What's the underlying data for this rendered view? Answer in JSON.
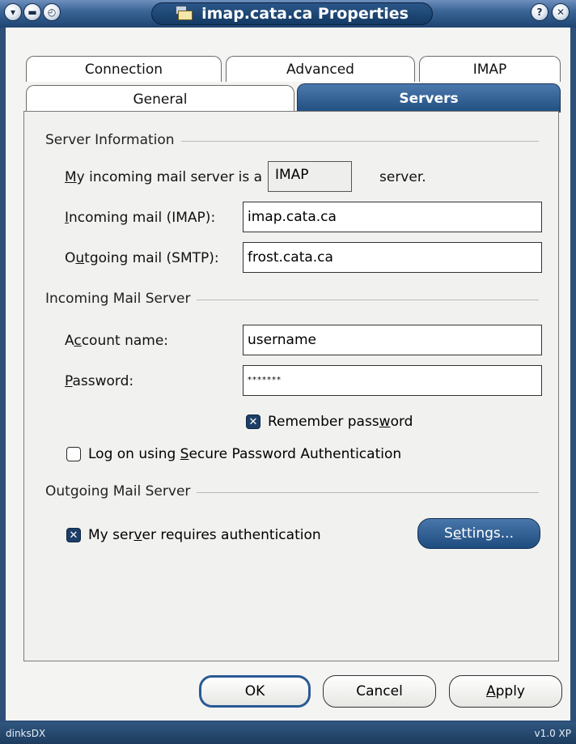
{
  "window": {
    "title": "imap.cata.ca Properties",
    "title_icon": "mail-account-icon",
    "left_buttons": [
      "system-menu-icon",
      "minimize-icon",
      "restore-icon"
    ],
    "right_buttons": [
      "help-icon",
      "close-icon"
    ]
  },
  "tabs": {
    "row1": [
      "Connection",
      "Advanced",
      "IMAP"
    ],
    "row2": [
      "General",
      "Servers"
    ],
    "active": "Servers"
  },
  "server_info": {
    "group_label": "Server Information",
    "type_prefix_u": "M",
    "type_prefix_rest": "y incoming mail server is a",
    "type_value": "IMAP",
    "type_suffix": "server.",
    "incoming_label_u": "I",
    "incoming_label_rest": "ncoming mail (IMAP):",
    "incoming_value": "imap.cata.ca",
    "outgoing_label_pre": "O",
    "outgoing_label_u": "u",
    "outgoing_label_rest": "tgoing mail (SMTP):",
    "outgoing_value": "frost.cata.ca"
  },
  "incoming_server": {
    "group_label": "Incoming Mail Server",
    "account_label_pre": "A",
    "account_label_u": "c",
    "account_label_rest": "count name:",
    "account_value": "username",
    "password_label_u": "P",
    "password_label_rest": "assword:",
    "password_value": "*******",
    "remember_pre": "Remember pass",
    "remember_u": "w",
    "remember_rest": "ord",
    "remember_checked": true,
    "spa_pre": "Log on using ",
    "spa_u": "S",
    "spa_rest": "ecure Password Authentication",
    "spa_checked": false
  },
  "outgoing_server": {
    "group_label": "Outgoing Mail Server",
    "auth_pre": "My ser",
    "auth_u": "v",
    "auth_rest": "er requires authentication",
    "auth_checked": true,
    "settings_pre": "S",
    "settings_u": "e",
    "settings_rest": "ttings..."
  },
  "buttons": {
    "ok": "OK",
    "cancel": "Cancel",
    "apply_u": "A",
    "apply_rest": "pply"
  },
  "statusbar": {
    "left": "dinksDX",
    "right": "v1.0 XP"
  },
  "colors": {
    "accent_blue": "#1f4e80",
    "titlebar": "#3a6596",
    "panel_bg": "#f1f1ef"
  }
}
